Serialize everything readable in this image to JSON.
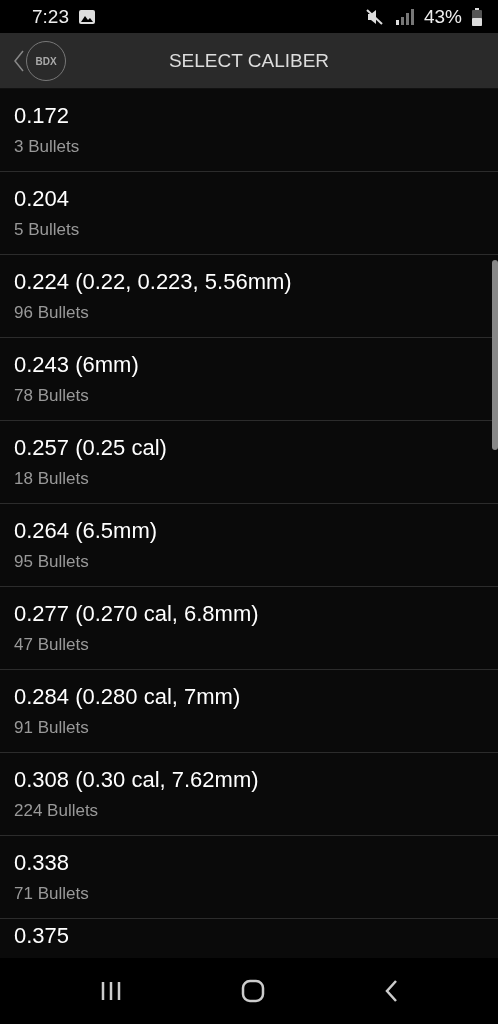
{
  "status_bar": {
    "time": "7:23",
    "battery": "43%"
  },
  "header": {
    "logo": "BDX",
    "title": "SELECT CALIBER"
  },
  "calibers": [
    {
      "name": "0.172",
      "count": "3 Bullets"
    },
    {
      "name": "0.204",
      "count": "5 Bullets"
    },
    {
      "name": "0.224 (0.22, 0.223, 5.56mm)",
      "count": "96 Bullets"
    },
    {
      "name": "0.243 (6mm)",
      "count": "78 Bullets"
    },
    {
      "name": "0.257 (0.25 cal)",
      "count": "18 Bullets"
    },
    {
      "name": "0.264 (6.5mm)",
      "count": "95 Bullets"
    },
    {
      "name": "0.277 (0.270 cal, 6.8mm)",
      "count": "47 Bullets"
    },
    {
      "name": "0.284 (0.280 cal, 7mm)",
      "count": "91 Bullets"
    },
    {
      "name": "0.308 (0.30 cal, 7.62mm)",
      "count": "224 Bullets"
    },
    {
      "name": "0.338",
      "count": "71 Bullets"
    },
    {
      "name": "0.375"
    }
  ]
}
